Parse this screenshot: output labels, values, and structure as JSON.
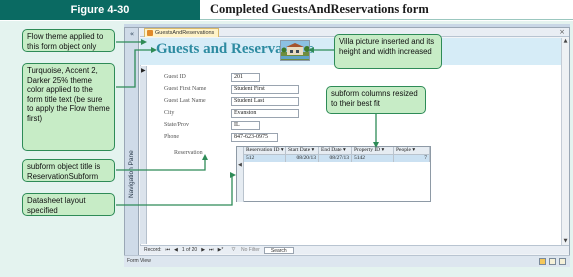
{
  "figure": {
    "number": "Figure 4-30",
    "title": "Completed GuestsAndReservations form"
  },
  "colors": {
    "figure_tag": "#0a6a62",
    "callout_fill": "#c7ecc6",
    "callout_border": "#2e8b57",
    "form_title": "#2d8ba1",
    "header_band": "#d6ecf7",
    "selected_row": "#cbe1f2"
  },
  "access": {
    "form_tab": "GuestsAndReservations",
    "navigation_pane_label": "Navigation Pane",
    "form_title": "Guests and Reservations",
    "fields": [
      {
        "label": "Guest ID",
        "value": "201"
      },
      {
        "label": "Guest First Name",
        "value": "Student First"
      },
      {
        "label": "Guest Last Name",
        "value": "Student Last"
      },
      {
        "label": "City",
        "value": "Evanston"
      },
      {
        "label": "State/Prov",
        "value": "IL"
      },
      {
        "label": "Phone",
        "value": "847-623-0975"
      }
    ],
    "subform": {
      "label": "Reservation",
      "columns": [
        "Reservation ID",
        "Start Date",
        "End Date",
        "Property ID",
        "People"
      ],
      "rows": [
        [
          "512",
          "08/20/13",
          "08/27/13",
          "5142",
          "7"
        ]
      ]
    },
    "record_nav": {
      "record_label": "Record:",
      "position": "1 of 20",
      "filter": "No Filter",
      "search": "Search"
    },
    "status": "Form View"
  },
  "callouts": {
    "flow_theme": "Flow theme applied to this form object only",
    "turquoise": "Turquoise, Accent 2, Darker 25% theme color applied to the form title text (be sure to apply the Flow theme first)",
    "subform_title": "subform object title is ReservationSubform",
    "datasheet": "Datasheet layout specified",
    "villa": "Villa picture inserted and its height and width increased",
    "columns": "subform columns resized to their best fit"
  },
  "icons": {
    "record_first": "⏮",
    "record_prev": "◀",
    "record_next": "▶",
    "record_last": "⏭",
    "record_new": "▶*",
    "filter": "funnel-icon",
    "nav_shutter": "«",
    "form_close": "×"
  }
}
